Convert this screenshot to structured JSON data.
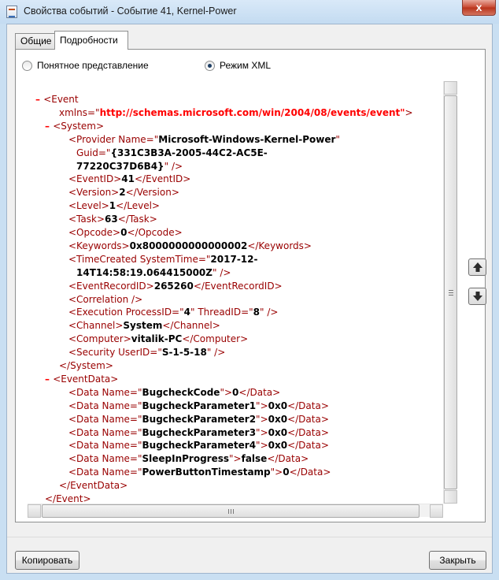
{
  "window": {
    "title": "Свойства событий - Событие 41, Kernel-Power",
    "close_symbol": "x"
  },
  "tabs": [
    {
      "label": "Общие",
      "active": false
    },
    {
      "label": "Подробности",
      "active": true
    }
  ],
  "view_mode": {
    "friendly_label": "Понятное представление",
    "xml_label": "Режим XML",
    "selected": "xml"
  },
  "xml_lines": [
    {
      "x": 10,
      "segments": [
        {
          "t": "minus",
          "v": "– "
        },
        {
          "t": "tag",
          "v": "<Event"
        }
      ]
    },
    {
      "x": 40,
      "segments": [
        {
          "t": "tag",
          "v": "xmlns=\""
        },
        {
          "t": "ns",
          "v": "http://schemas.microsoft.com/win/2004/08/events/event\""
        },
        {
          "t": "tag",
          "v": ">"
        }
      ]
    },
    {
      "x": 22,
      "segments": [
        {
          "t": "minus",
          "v": "– "
        },
        {
          "t": "tag",
          "v": "<System>"
        }
      ]
    },
    {
      "x": 52,
      "segments": [
        {
          "t": "tag",
          "v": "<Provider Name=\""
        },
        {
          "t": "val",
          "v": "Microsoft-Windows-Kernel-Power"
        },
        {
          "t": "tag",
          "v": "\""
        }
      ]
    },
    {
      "x": 62,
      "segments": [
        {
          "t": "tag",
          "v": "Guid=\""
        },
        {
          "t": "val",
          "v": "{331C3B3A-2005-44C2-AC5E-"
        }
      ]
    },
    {
      "x": 62,
      "segments": [
        {
          "t": "val",
          "v": "77220C37D6B4}"
        },
        {
          "t": "tag",
          "v": "\" />"
        }
      ]
    },
    {
      "x": 52,
      "segments": [
        {
          "t": "tag",
          "v": "<EventID>"
        },
        {
          "t": "val",
          "v": "41"
        },
        {
          "t": "tag",
          "v": "</EventID>"
        }
      ]
    },
    {
      "x": 52,
      "segments": [
        {
          "t": "tag",
          "v": "<Version>"
        },
        {
          "t": "val",
          "v": "2"
        },
        {
          "t": "tag",
          "v": "</Version>"
        }
      ]
    },
    {
      "x": 52,
      "segments": [
        {
          "t": "tag",
          "v": "<Level>"
        },
        {
          "t": "val",
          "v": "1"
        },
        {
          "t": "tag",
          "v": "</Level>"
        }
      ]
    },
    {
      "x": 52,
      "segments": [
        {
          "t": "tag",
          "v": "<Task>"
        },
        {
          "t": "val",
          "v": "63"
        },
        {
          "t": "tag",
          "v": "</Task>"
        }
      ]
    },
    {
      "x": 52,
      "segments": [
        {
          "t": "tag",
          "v": "<Opcode>"
        },
        {
          "t": "val",
          "v": "0"
        },
        {
          "t": "tag",
          "v": "</Opcode>"
        }
      ]
    },
    {
      "x": 52,
      "segments": [
        {
          "t": "tag",
          "v": "<Keywords>"
        },
        {
          "t": "val",
          "v": "0x8000000000000002"
        },
        {
          "t": "tag",
          "v": "</Keywords>"
        }
      ]
    },
    {
      "x": 52,
      "segments": [
        {
          "t": "tag",
          "v": "<TimeCreated SystemTime=\""
        },
        {
          "t": "val",
          "v": "2017-12-"
        }
      ]
    },
    {
      "x": 62,
      "segments": [
        {
          "t": "val",
          "v": "14T14:58:19.064415000Z"
        },
        {
          "t": "tag",
          "v": "\" />"
        }
      ]
    },
    {
      "x": 52,
      "segments": [
        {
          "t": "tag",
          "v": "<EventRecordID>"
        },
        {
          "t": "val",
          "v": "265260"
        },
        {
          "t": "tag",
          "v": "</EventRecordID>"
        }
      ]
    },
    {
      "x": 52,
      "segments": [
        {
          "t": "tag",
          "v": "<Correlation />"
        }
      ]
    },
    {
      "x": 52,
      "segments": [
        {
          "t": "tag",
          "v": "<Execution ProcessID=\""
        },
        {
          "t": "val",
          "v": "4"
        },
        {
          "t": "tag",
          "v": "\" ThreadID=\""
        },
        {
          "t": "val",
          "v": "8"
        },
        {
          "t": "tag",
          "v": "\" />"
        }
      ]
    },
    {
      "x": 52,
      "segments": [
        {
          "t": "tag",
          "v": "<Channel>"
        },
        {
          "t": "val",
          "v": "System"
        },
        {
          "t": "tag",
          "v": "</Channel>"
        }
      ]
    },
    {
      "x": 52,
      "segments": [
        {
          "t": "tag",
          "v": "<Computer>"
        },
        {
          "t": "val",
          "v": "vitalik-PC"
        },
        {
          "t": "tag",
          "v": "</Computer>"
        }
      ]
    },
    {
      "x": 52,
      "segments": [
        {
          "t": "tag",
          "v": "<Security UserID=\""
        },
        {
          "t": "val",
          "v": "S-1-5-18"
        },
        {
          "t": "tag",
          "v": "\" />"
        }
      ]
    },
    {
      "x": 40,
      "segments": [
        {
          "t": "tag",
          "v": "</System>"
        }
      ]
    },
    {
      "x": 22,
      "segments": [
        {
          "t": "minus",
          "v": "– "
        },
        {
          "t": "tag",
          "v": "<EventData>"
        }
      ]
    },
    {
      "x": 52,
      "segments": [
        {
          "t": "tag",
          "v": "<Data Name=\""
        },
        {
          "t": "val",
          "v": "BugcheckCode"
        },
        {
          "t": "tag",
          "v": "\">"
        },
        {
          "t": "val",
          "v": "0"
        },
        {
          "t": "tag",
          "v": "</Data>"
        }
      ]
    },
    {
      "x": 52,
      "segments": [
        {
          "t": "tag",
          "v": "<Data Name=\""
        },
        {
          "t": "val",
          "v": "BugcheckParameter1"
        },
        {
          "t": "tag",
          "v": "\">"
        },
        {
          "t": "val",
          "v": "0x0"
        },
        {
          "t": "tag",
          "v": "</Data>"
        }
      ]
    },
    {
      "x": 52,
      "segments": [
        {
          "t": "tag",
          "v": "<Data Name=\""
        },
        {
          "t": "val",
          "v": "BugcheckParameter2"
        },
        {
          "t": "tag",
          "v": "\">"
        },
        {
          "t": "val",
          "v": "0x0"
        },
        {
          "t": "tag",
          "v": "</Data>"
        }
      ]
    },
    {
      "x": 52,
      "segments": [
        {
          "t": "tag",
          "v": "<Data Name=\""
        },
        {
          "t": "val",
          "v": "BugcheckParameter3"
        },
        {
          "t": "tag",
          "v": "\">"
        },
        {
          "t": "val",
          "v": "0x0"
        },
        {
          "t": "tag",
          "v": "</Data>"
        }
      ]
    },
    {
      "x": 52,
      "segments": [
        {
          "t": "tag",
          "v": "<Data Name=\""
        },
        {
          "t": "val",
          "v": "BugcheckParameter4"
        },
        {
          "t": "tag",
          "v": "\">"
        },
        {
          "t": "val",
          "v": "0x0"
        },
        {
          "t": "tag",
          "v": "</Data>"
        }
      ]
    },
    {
      "x": 52,
      "segments": [
        {
          "t": "tag",
          "v": "<Data Name=\""
        },
        {
          "t": "val",
          "v": "SleepInProgress"
        },
        {
          "t": "tag",
          "v": "\">"
        },
        {
          "t": "val",
          "v": "false"
        },
        {
          "t": "tag",
          "v": "</Data>"
        }
      ]
    },
    {
      "x": 52,
      "segments": [
        {
          "t": "tag",
          "v": "<Data Name=\""
        },
        {
          "t": "val",
          "v": "PowerButtonTimestamp"
        },
        {
          "t": "tag",
          "v": "\">"
        },
        {
          "t": "val",
          "v": "0"
        },
        {
          "t": "tag",
          "v": "</Data>"
        }
      ]
    },
    {
      "x": 40,
      "segments": [
        {
          "t": "tag",
          "v": "</EventData>"
        }
      ]
    },
    {
      "x": 22,
      "segments": [
        {
          "t": "tag",
          "v": "</Event>"
        }
      ]
    }
  ],
  "buttons": {
    "copy_label": "Копировать",
    "close_label": "Закрыть",
    "prev_event_icon": "arrow-up-icon",
    "next_event_icon": "arrow-down-icon"
  },
  "colors": {
    "tag": "#990000",
    "namespace": "#ff0000",
    "value": "#000000"
  }
}
